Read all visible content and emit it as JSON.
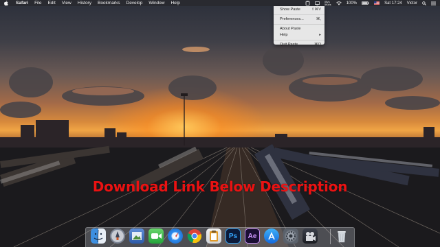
{
  "menubar": {
    "apple_icon": "apple-icon",
    "items": [
      {
        "label": "Safari"
      },
      {
        "label": "File"
      },
      {
        "label": "Edit"
      },
      {
        "label": "View"
      },
      {
        "label": "History"
      },
      {
        "label": "Bookmarks"
      },
      {
        "label": "Develop"
      },
      {
        "label": "Window"
      },
      {
        "label": "Help"
      }
    ],
    "status": {
      "paste_icon": "paste-clipboard-icon",
      "network_speed_up": "0B/s",
      "network_speed_down": "5Kb/s",
      "wifi_icon": "wifi-icon",
      "battery_label": "100%",
      "battery_icon": "battery-icon",
      "flag_icon": "us-flag-icon",
      "clock": "Sat 17:24",
      "user": "Victor",
      "search_icon": "spotlight-search-icon",
      "notification_icon": "notification-center-icon"
    }
  },
  "paste_menu": {
    "items": [
      {
        "label": "Show Paste",
        "shortcut": "⇧⌘V"
      },
      {
        "label": "Preferences...",
        "shortcut": "⌘,"
      },
      {
        "label": "About Paste",
        "shortcut": ""
      },
      {
        "label": "Help",
        "shortcut": "▸"
      },
      {
        "label": "Quit Paste",
        "shortcut": "⌘Q"
      }
    ]
  },
  "overlay": {
    "text": "Download Link Below Description",
    "color": "#ea1212"
  },
  "dock": {
    "icons": [
      {
        "name": "finder-icon"
      },
      {
        "name": "launchpad-icon"
      },
      {
        "name": "preview-icon"
      },
      {
        "name": "facetime-icon"
      },
      {
        "name": "safari-icon"
      },
      {
        "name": "chrome-icon"
      },
      {
        "name": "paste-app-icon"
      },
      {
        "name": "photoshop-icon",
        "label": "Ps"
      },
      {
        "name": "after-effects-icon",
        "label": "Ae"
      },
      {
        "name": "app-store-icon"
      },
      {
        "name": "system-preferences-icon"
      },
      {
        "name": "imovie-icon"
      },
      {
        "name": "trash-icon"
      }
    ]
  }
}
